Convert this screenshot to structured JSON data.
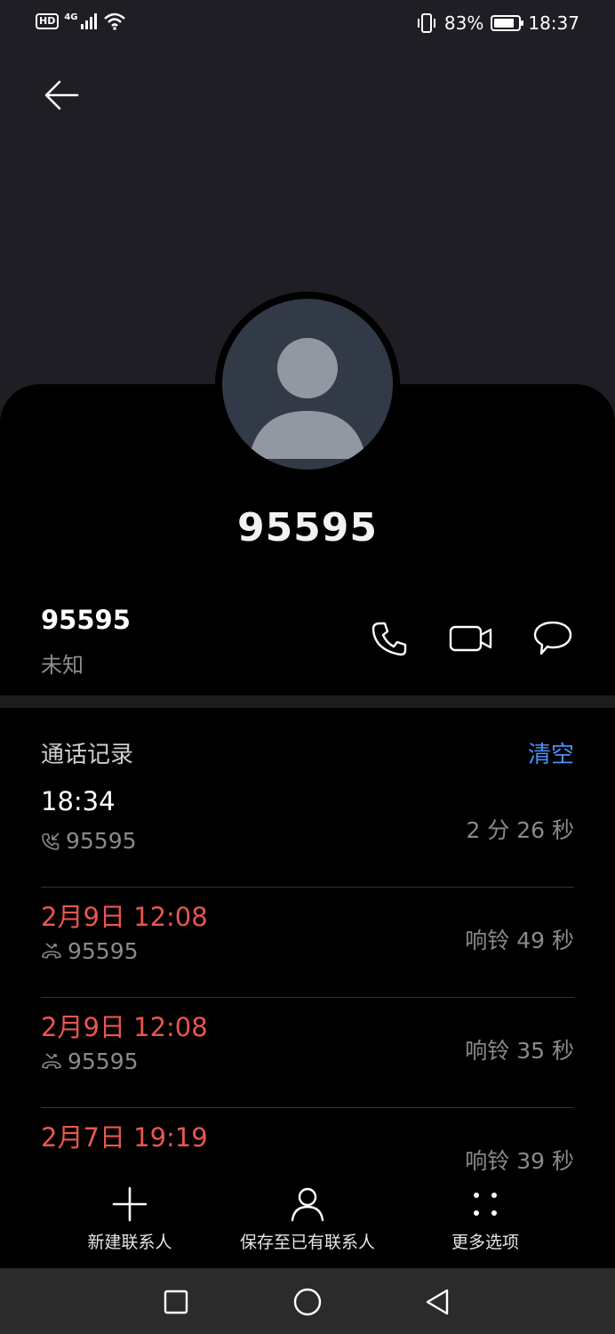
{
  "status_bar": {
    "hd": "HD",
    "network": "4G",
    "battery_percent": "83%",
    "battery_level": 0.83,
    "time": "18:37"
  },
  "contact": {
    "display_name": "95595",
    "number": "95595",
    "number_type": "未知"
  },
  "actions": [
    "phone-icon",
    "video-call-icon",
    "message-icon"
  ],
  "call_log": {
    "title": "通话记录",
    "clear_label": "清空",
    "entries": [
      {
        "time": "18:34",
        "number": "95595",
        "duration": "2 分 26 秒",
        "missed": false,
        "icon": "incoming-call-icon"
      },
      {
        "time": "2月9日 12:08",
        "number": "95595",
        "duration": "响铃 49 秒",
        "missed": true,
        "icon": "missed-call-icon"
      },
      {
        "time": "2月9日 12:08",
        "number": "95595",
        "duration": "响铃 35 秒",
        "missed": true,
        "icon": "missed-call-icon"
      },
      {
        "time": "2月7日 19:19",
        "number": "",
        "duration": "响铃 39 秒",
        "missed": true,
        "icon": "missed-call-icon"
      }
    ]
  },
  "toolbar": {
    "new_contact": "新建联系人",
    "save_existing": "保存至已有联系人",
    "more_options": "更多选项"
  },
  "colors": {
    "header_bg": "#1f1e24",
    "accent": "#4d8ff7",
    "missed": "#e8564f"
  }
}
